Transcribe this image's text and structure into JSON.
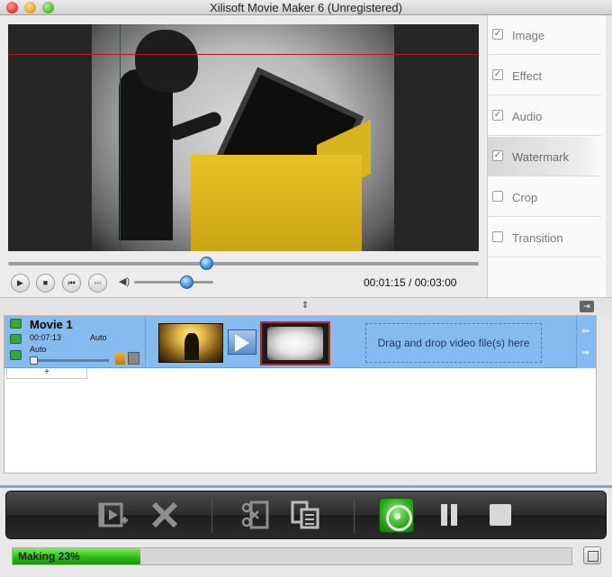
{
  "window": {
    "title": "Xilisoft Movie Maker 6 (Unregistered)"
  },
  "player": {
    "seek_position": 0.42,
    "volume_level": 0.62,
    "timecode": "00:01:15 / 00:03:00",
    "controls": [
      "play-icon",
      "stop-icon",
      "prev-icon",
      "next-icon",
      "volume-icon"
    ]
  },
  "sidepanel": {
    "items": [
      {
        "label": "Image",
        "checked": true
      },
      {
        "label": "Effect",
        "checked": true
      },
      {
        "label": "Audio",
        "checked": true
      },
      {
        "label": "Watermark",
        "checked": true,
        "selected": true
      },
      {
        "label": "Crop",
        "checked": false
      },
      {
        "label": "Transition",
        "checked": false
      }
    ]
  },
  "timeline": {
    "movie": {
      "title": "Movie 1",
      "duration": "00:07:13",
      "auto1": "Auto",
      "auto2": "Auto"
    },
    "drop_hint": "Drag and drop video file(s) here",
    "add_tab": "+"
  },
  "toolbar": {
    "buttons": [
      "add-video-icon",
      "delete-icon",
      "cut-icon",
      "merge-icon",
      "start-icon",
      "pause-icon",
      "stop-icon"
    ]
  },
  "status": {
    "progress_label": "Making 23%",
    "progress": 0.23
  },
  "colors": {
    "accent_blue": "#86bbef",
    "progress_green": "#2fb51a",
    "crosshair_red": "#c0111d"
  }
}
